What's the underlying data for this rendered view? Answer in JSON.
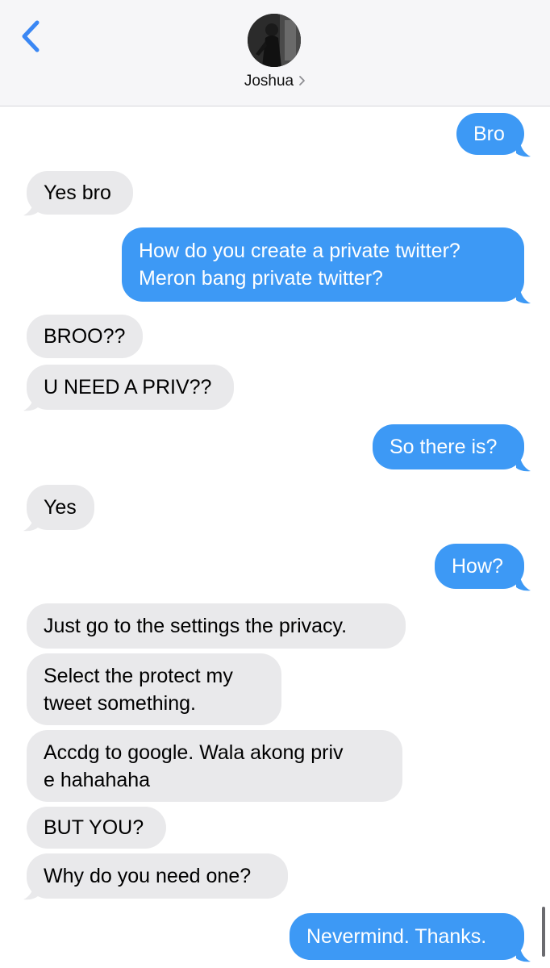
{
  "header": {
    "contact_name": "Joshua"
  },
  "messages": [
    {
      "from": "me",
      "text": "Bro"
    },
    {
      "from": "them",
      "text": "Yes bro"
    },
    {
      "from": "me",
      "lines": [
        "How do you create a private twitter?",
        "Meron bang private twitter?"
      ]
    },
    {
      "from": "them",
      "text": "BROO??"
    },
    {
      "from": "them",
      "text": "U NEED A PRIV??"
    },
    {
      "from": "me",
      "text": "So there is?"
    },
    {
      "from": "them",
      "text": "Yes"
    },
    {
      "from": "me",
      "text": "How?"
    },
    {
      "from": "them",
      "text": "Just go to the settings the privacy."
    },
    {
      "from": "them",
      "lines": [
        "Select the protect my",
        "tweet something."
      ]
    },
    {
      "from": "them",
      "lines": [
        "Accdg to google. Wala akong priv",
        "e hahahaha"
      ]
    },
    {
      "from": "them",
      "text": "BUT YOU?"
    },
    {
      "from": "them",
      "text": "Why do you need one?"
    },
    {
      "from": "me",
      "text": "Nevermind. Thanks."
    }
  ],
  "colors": {
    "sent_bubble": "#3d99f5",
    "received_bubble": "#e9e9eb",
    "header_bg": "#f6f6f8",
    "accent": "#3a87f4"
  },
  "icons": {
    "back": "chevron-left-icon",
    "contact_details": "chevron-right-icon"
  }
}
